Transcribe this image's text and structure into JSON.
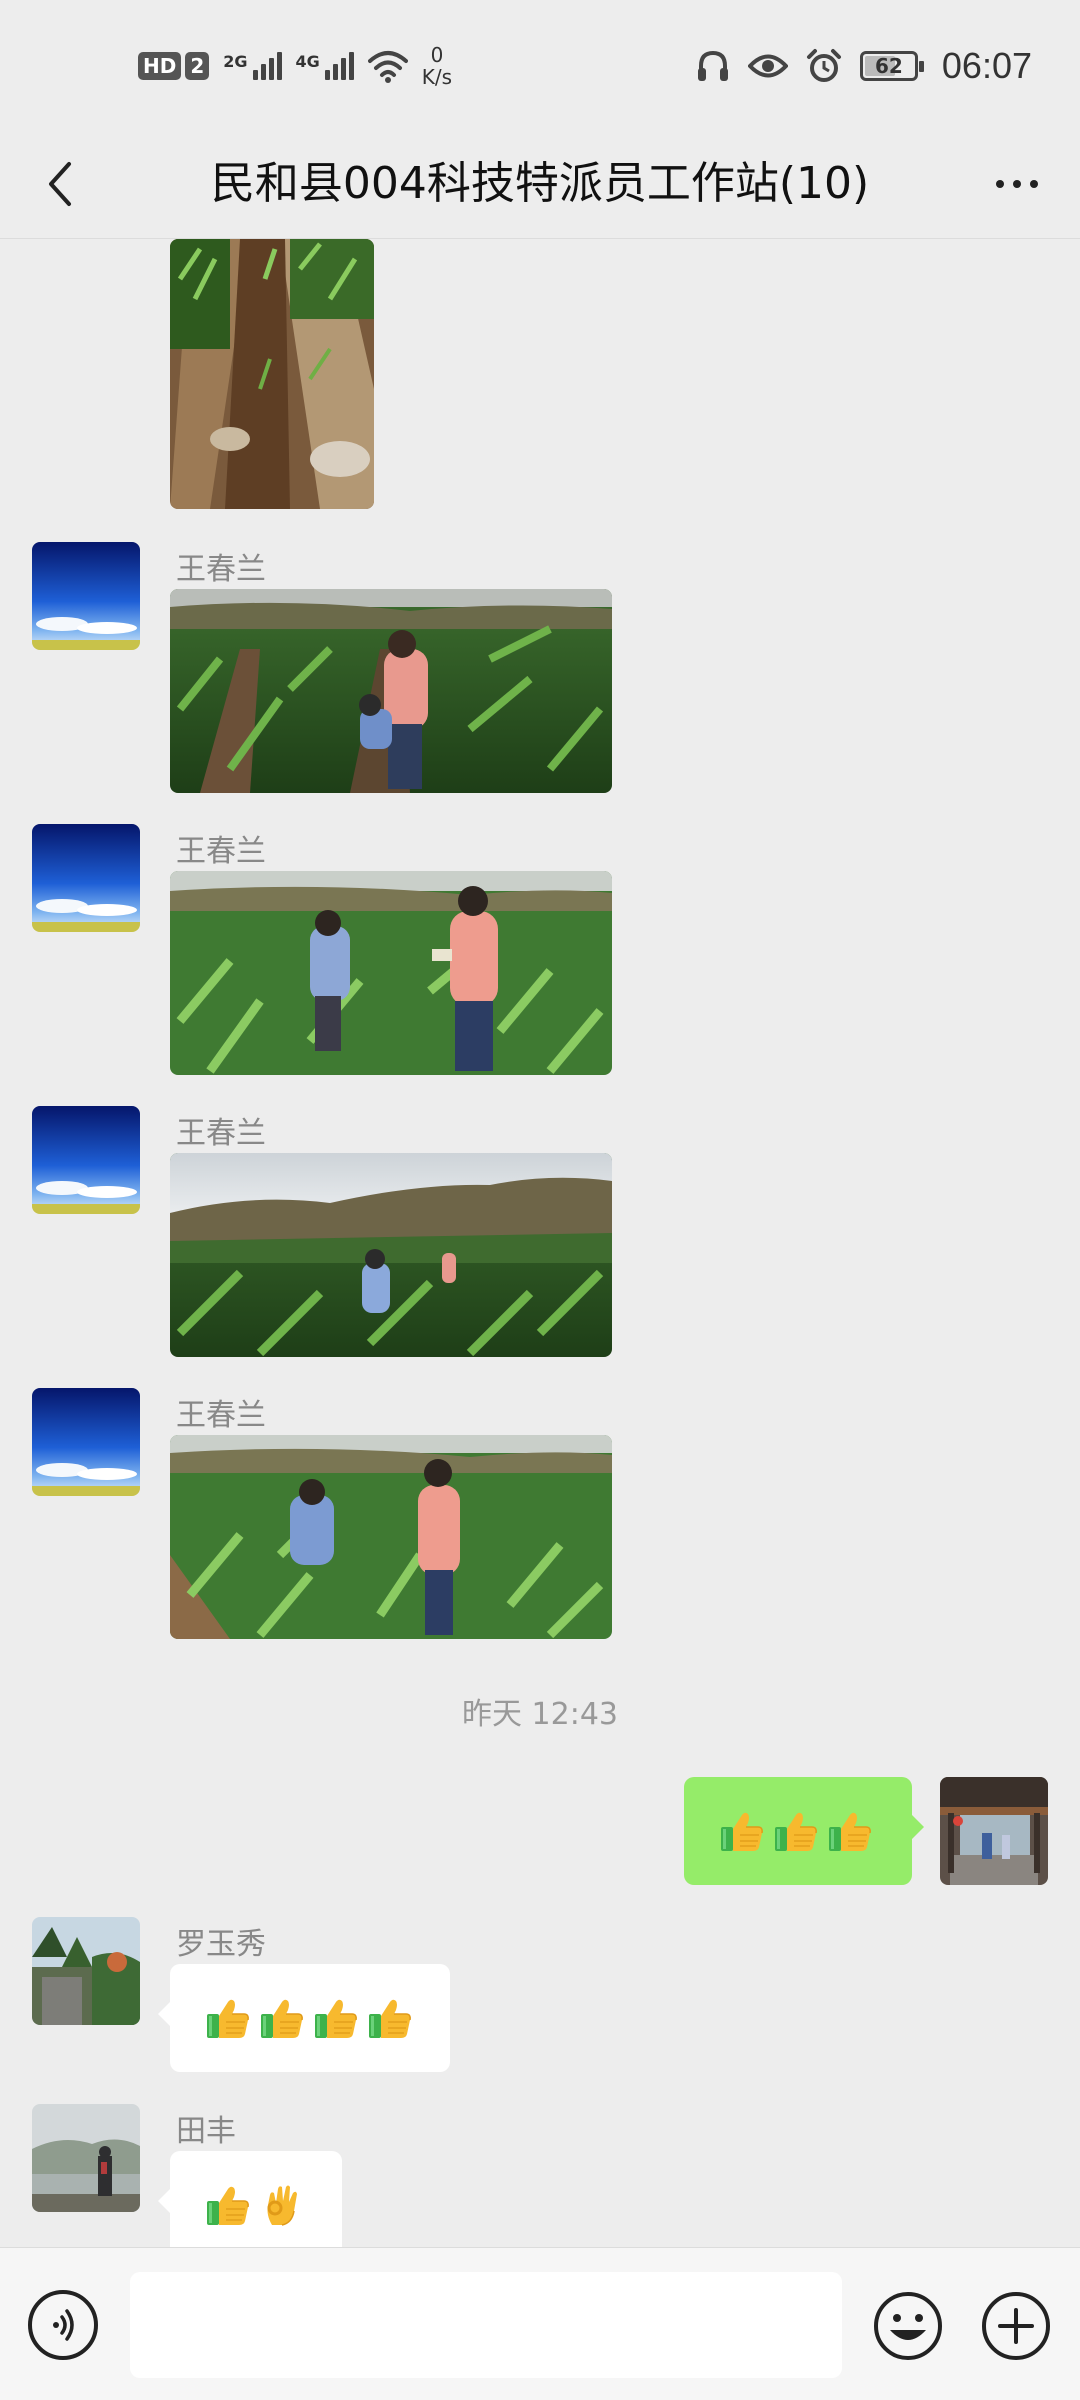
{
  "status_bar": {
    "hd_label": "HD",
    "sim_number": "2",
    "net1_gen": "2G",
    "net2_gen": "4G",
    "speed_value": "0",
    "speed_unit": "K/s",
    "battery_level": "62",
    "battery_fraction": 0.62,
    "time": "06:07",
    "icons": [
      "headphones-icon",
      "eye-icon",
      "alarm-icon",
      "wifi-icon",
      "signal-icon"
    ]
  },
  "header": {
    "title": "民和县004科技特派员工作站(10)",
    "back_icon": "chevron-left-icon",
    "more_icon": "more-icon"
  },
  "messages": [
    {
      "type": "image",
      "sender": "",
      "image": "seedling-rows-photo"
    },
    {
      "type": "image",
      "sender": "王春兰",
      "image": "cornfield-photo-1"
    },
    {
      "type": "image",
      "sender": "王春兰",
      "image": "cornfield-photo-2"
    },
    {
      "type": "image",
      "sender": "王春兰",
      "image": "cornfield-photo-3"
    },
    {
      "type": "image",
      "sender": "王春兰",
      "image": "cornfield-photo-4"
    },
    {
      "type": "time",
      "text": "昨天 12:43"
    },
    {
      "type": "emoji",
      "side": "right",
      "emojis": [
        "thumbs-up",
        "thumbs-up",
        "thumbs-up"
      ]
    },
    {
      "type": "emoji",
      "side": "left",
      "sender": "罗玉秀",
      "emojis": [
        "thumbs-up",
        "thumbs-up",
        "thumbs-up",
        "thumbs-up"
      ]
    },
    {
      "type": "emoji",
      "side": "left",
      "sender": "田丰",
      "emojis": [
        "thumbs-up",
        "ok-hand"
      ]
    }
  ],
  "input_bar": {
    "voice_icon": "voice-icon",
    "input_value": "",
    "emoji_icon": "emoji-icon",
    "plus_icon": "plus-icon"
  },
  "colors": {
    "background": "#EDEDED",
    "my_bubble": "#95EC69",
    "their_bubble": "#FFFFFF",
    "sender_name": "#888888",
    "thumb_yellow": "#F7B92E",
    "cuff_green": "#3DB24B"
  }
}
